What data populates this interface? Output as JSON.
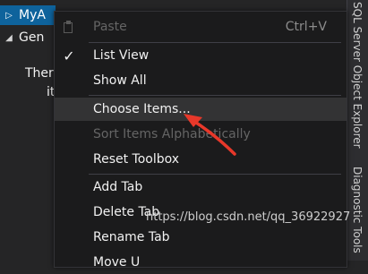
{
  "toolbox": {
    "items": [
      {
        "label": "MyA",
        "expanded": false,
        "selected": true
      },
      {
        "label": "Gen",
        "expanded": true,
        "selected": false
      }
    ],
    "empty_message_line1": "There",
    "empty_message_line2": "it"
  },
  "context_menu": {
    "items": [
      {
        "label": "Paste",
        "shortcut": "Ctrl+V",
        "enabled": false,
        "icon": "paste-icon"
      },
      {
        "label": "List View",
        "checked": true,
        "enabled": true
      },
      {
        "label": "Show All",
        "enabled": true
      },
      {
        "label": "Choose Items...",
        "enabled": true,
        "highlighted": true
      },
      {
        "label": "Sort Items Alphabetically",
        "enabled": false
      },
      {
        "label": "Reset Toolbox",
        "enabled": true
      },
      {
        "label": "Add Tab",
        "enabled": true
      },
      {
        "label": "Delete Tab",
        "enabled": true
      },
      {
        "label": "Rename Tab",
        "enabled": true
      },
      {
        "label": "Move U",
        "enabled": true
      }
    ],
    "check_glyph": "✓"
  },
  "side_tabs": {
    "top": "SQL Server Object Explorer",
    "bottom": "Diagnostic Tools"
  },
  "annotation": {
    "color": "#e8382a"
  },
  "watermark": {
    "text": "https://blog.csdn.net/qq_36922927"
  },
  "colors": {
    "selection": "#0e639c",
    "menu_background": "#1b1b1c",
    "menu_hover": "#333334",
    "disabled_text": "#656565"
  }
}
